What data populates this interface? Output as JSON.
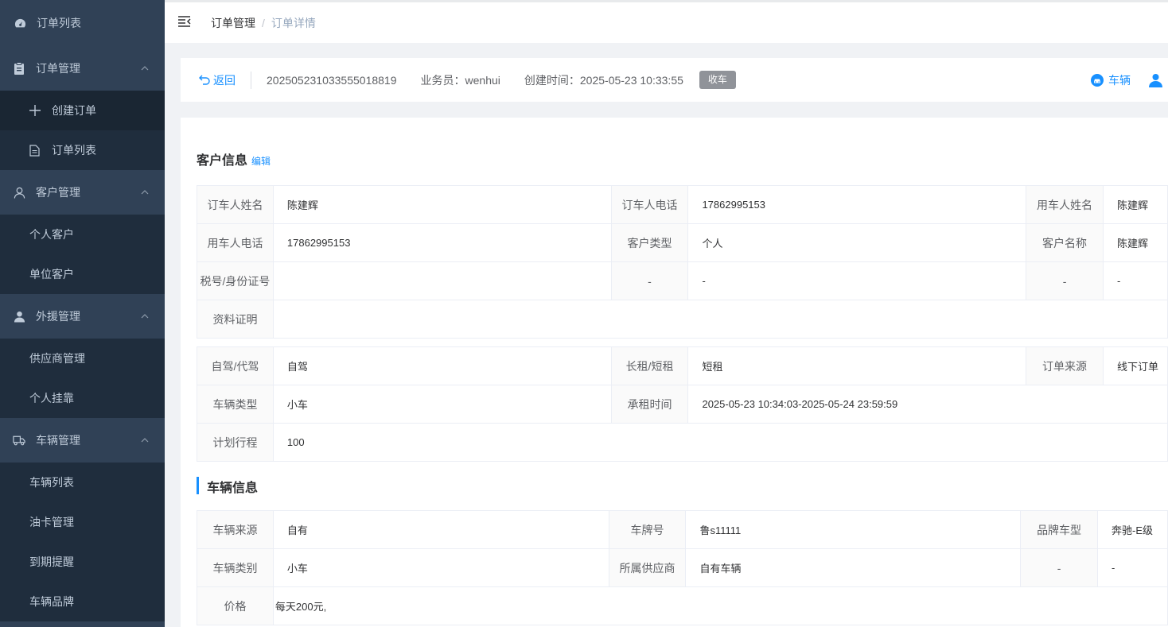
{
  "sidebar": {
    "top_item": {
      "label": "订单列表",
      "icon": "dashboard-icon"
    },
    "groups": [
      {
        "label": "订单管理",
        "icon": "clipboard-icon",
        "children": [
          {
            "label": "创建订单",
            "icon": "plus-icon"
          },
          {
            "label": "订单列表",
            "icon": "document-icon"
          }
        ]
      },
      {
        "label": "客户管理",
        "icon": "user-outline-icon",
        "children": [
          {
            "label": "个人客户"
          },
          {
            "label": "单位客户"
          }
        ]
      },
      {
        "label": "外援管理",
        "icon": "user-filled-icon",
        "children": [
          {
            "label": "供应商管理"
          },
          {
            "label": "个人挂靠"
          }
        ]
      },
      {
        "label": "车辆管理",
        "icon": "truck-icon",
        "children": [
          {
            "label": "车辆列表"
          },
          {
            "label": "油卡管理"
          },
          {
            "label": "到期提醒"
          },
          {
            "label": "车辆品牌"
          }
        ]
      }
    ]
  },
  "breadcrumb": {
    "parent": "订单管理",
    "sep": "/",
    "current": "订单详情"
  },
  "infobar": {
    "back_label": "返回",
    "order_no": "20250523103355501881​9",
    "salesman": "业务员：wenhui",
    "created": "创建时间：2025-05-23 10:33:55",
    "status_tag": "收车",
    "vehicle_link": "车辆"
  },
  "customer": {
    "title": "客户信息",
    "edit": "编辑",
    "rows": [
      [
        [
          "订车人姓名",
          "陈建辉"
        ],
        [
          "订车人电话",
          "17862995153"
        ],
        [
          "用车人姓名",
          "陈建辉"
        ]
      ],
      [
        [
          "用车人电话",
          "17862995153"
        ],
        [
          "客户类型",
          "个人"
        ],
        [
          "客户名称",
          "陈建辉"
        ]
      ],
      [
        [
          "税号/身份证号",
          ""
        ],
        [
          "-",
          "-"
        ],
        [
          "-",
          "-"
        ]
      ]
    ],
    "proof_label": "资料证明",
    "proof_value": ""
  },
  "order": {
    "rows": [
      [
        [
          "自驾/代驾",
          "自驾"
        ],
        [
          "长租/短租",
          "短租"
        ],
        [
          "订单来源",
          "线下订单"
        ]
      ],
      [
        [
          "车辆类型",
          "小车"
        ],
        [
          "承租时间",
          "2025-05-23 10:34:03-2025-05-24 23:59:59"
        ]
      ]
    ],
    "plan_label": "计划行程",
    "plan_value": "100"
  },
  "vehicle": {
    "title": "车辆信息",
    "rows": [
      [
        [
          "车辆来源",
          "自有"
        ],
        [
          "车牌号",
          "鲁s11111"
        ],
        [
          "品牌车型",
          "奔驰-E级"
        ]
      ],
      [
        [
          "车辆类别",
          "小车"
        ],
        [
          "所属供应商",
          "自有车辆"
        ],
        [
          "-",
          "-"
        ]
      ]
    ],
    "price_label": "价格",
    "price_value": "每天200元,"
  },
  "colors": {
    "sidebar": "#304156",
    "accent": "#1890ff",
    "tag": "#909399"
  }
}
